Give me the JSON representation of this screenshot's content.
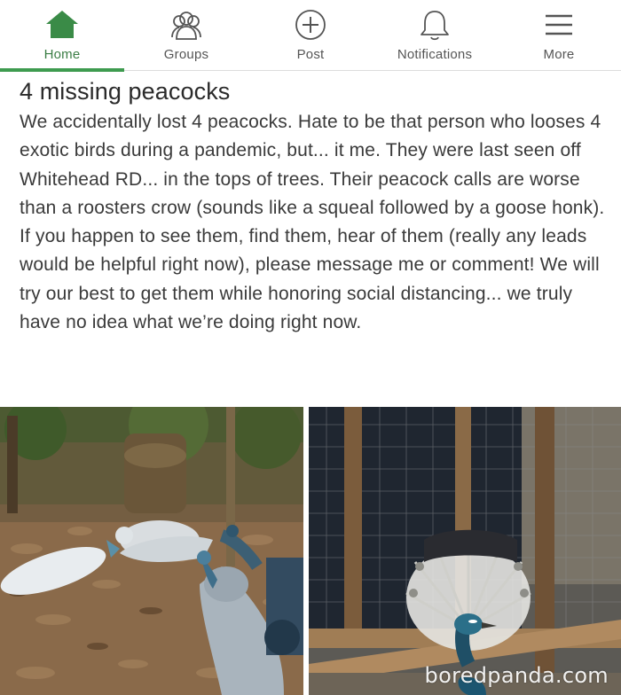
{
  "nav": {
    "items": [
      {
        "label": "Home",
        "icon": "home-icon"
      },
      {
        "label": "Groups",
        "icon": "groups-icon"
      },
      {
        "label": "Post",
        "icon": "post-icon"
      },
      {
        "label": "Notifications",
        "icon": "bell-icon"
      },
      {
        "label": "More",
        "icon": "menu-icon"
      }
    ],
    "active_index": 0,
    "accent_color": "#3e9b4f"
  },
  "post": {
    "title": "4 missing peacocks",
    "body": "We accidentally lost 4 peacocks. Hate to be that person who looses 4 exotic birds during a pandemic, but... it me. They were last seen off Whitehead RD... in the tops of trees. Their peacock calls are worse than a roosters crow (sounds like a squeal followed by a goose honk). If you happen to see them, find them, hear of them (really any leads would be helpful right now), please message me or comment! We will try our best to get them while honoring social distancing... we truly have no idea what we’re doing right now."
  },
  "photos": {
    "watermark": "boredpanda.com"
  }
}
